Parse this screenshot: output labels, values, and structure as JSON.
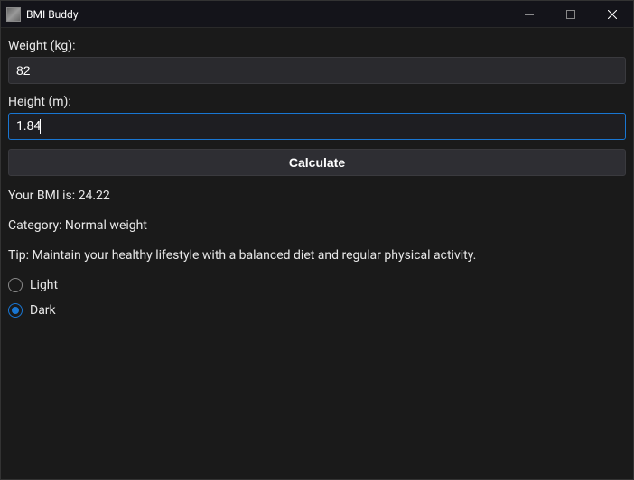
{
  "titlebar": {
    "title": "BMI Buddy"
  },
  "weight": {
    "label": "Weight (kg):",
    "value": "82"
  },
  "height": {
    "label": "Height (m):",
    "value": "1.84"
  },
  "calculate_label": "Calculate",
  "results": {
    "bmi": "Your BMI is: 24.22",
    "category": "Category: Normal weight",
    "tip": "Tip: Maintain your healthy lifestyle with a balanced diet and regular physical activity."
  },
  "theme": {
    "light_label": "Light",
    "dark_label": "Dark",
    "selected": "dark"
  }
}
